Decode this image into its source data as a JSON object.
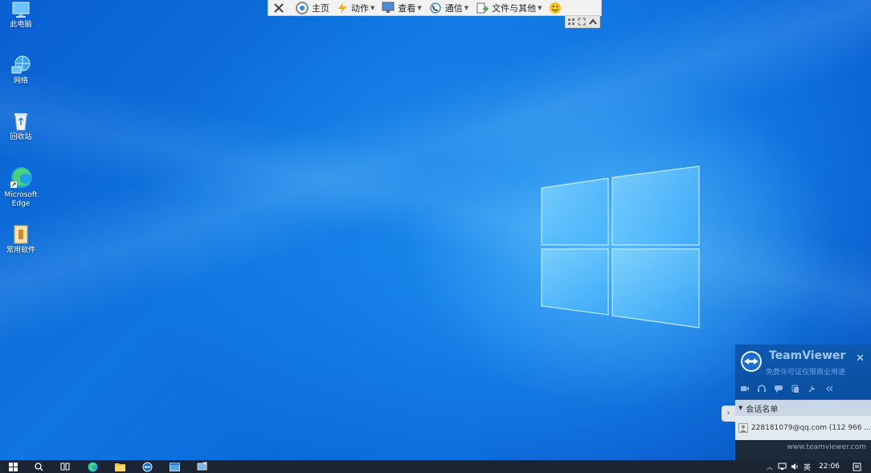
{
  "desktop": {
    "icons": [
      {
        "label": "此电脑",
        "icon": "this-pc-icon"
      },
      {
        "label": "网络",
        "icon": "network-icon"
      },
      {
        "label": "回收站",
        "icon": "recycle-bin-icon"
      },
      {
        "label": "Microsoft Edge",
        "icon": "edge-icon"
      },
      {
        "label": "常用软件",
        "icon": "folder-icon"
      }
    ]
  },
  "toolbar": {
    "home_label": "主页",
    "actions_label": "动作",
    "view_label": "查看",
    "comm_label": "通信",
    "files_label": "文件与其他"
  },
  "teamviewer": {
    "title": "TeamViewer",
    "subtitle": "免费许可证仅限商业用途",
    "section_label": "会话名单",
    "contact": "228181079@qq.com (112 966 ...",
    "footer": "www.teamviewer.com",
    "accent": "#0d4f9e"
  },
  "taskbar": {
    "time": "22:06",
    "ime": "英"
  }
}
